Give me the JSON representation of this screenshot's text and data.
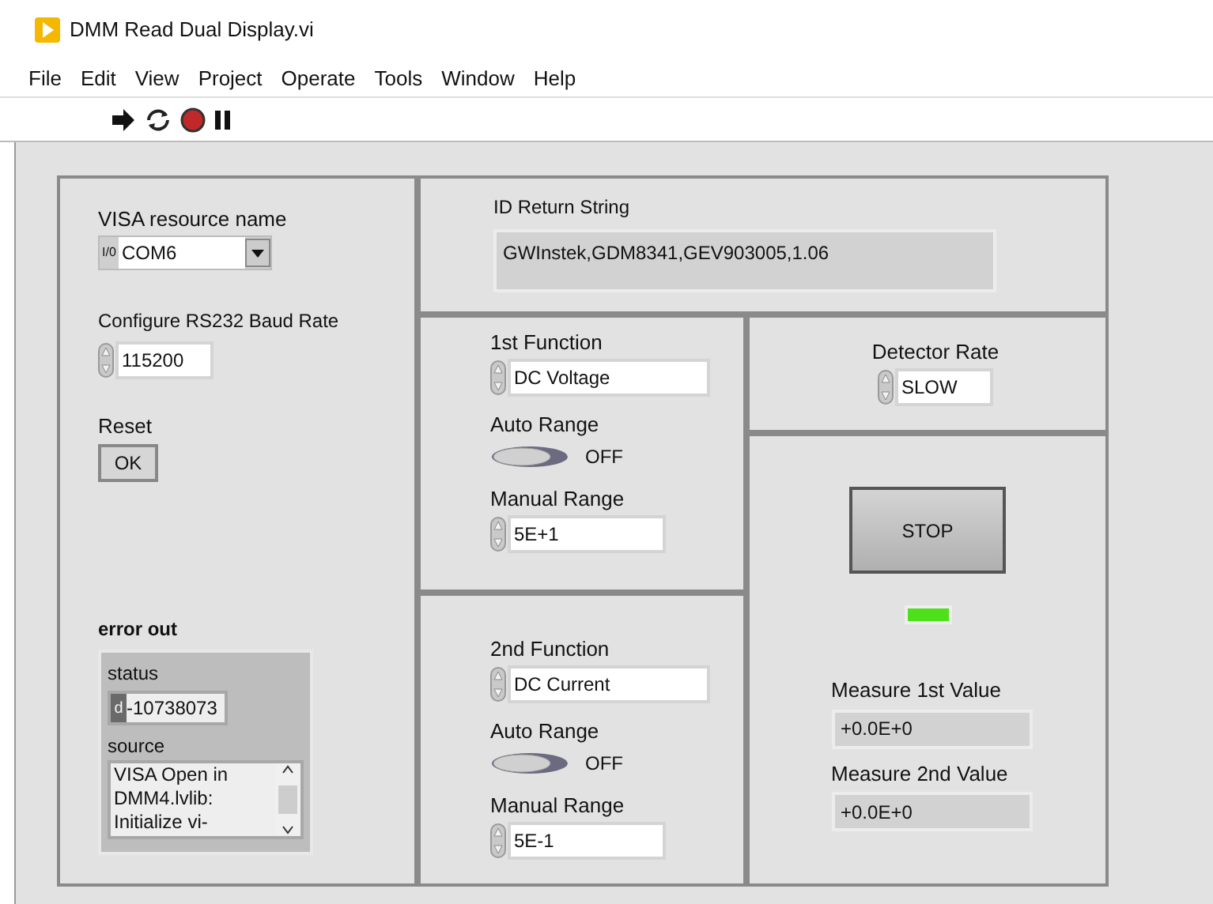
{
  "window": {
    "title": "DMM Read Dual Display.vi"
  },
  "menu": [
    "File",
    "Edit",
    "View",
    "Project",
    "Operate",
    "Tools",
    "Window",
    "Help"
  ],
  "visa": {
    "label": "VISA resource name",
    "prefix": "I/0",
    "value": "COM6"
  },
  "baud": {
    "label": "Configure RS232 Baud Rate",
    "value": "115200"
  },
  "reset": {
    "label": "Reset",
    "button": "OK"
  },
  "error_out": {
    "label": "error out",
    "status_label": "status",
    "code_prefix": "d",
    "code": "-10738073",
    "source_label": "source",
    "source": "VISA Open in DMM4.lvlib: Initialize vi-"
  },
  "id_string": {
    "label": "ID Return String",
    "value": "GWInstek,GDM8341,GEV903005,1.06"
  },
  "functions": [
    {
      "label": "1st Function",
      "value": "DC Voltage",
      "auto_label": "Auto Range",
      "auto_on": false,
      "auto_text": "OFF",
      "manual_label": "Manual Range",
      "manual_value": "5E+1"
    },
    {
      "label": "2nd Function",
      "value": "DC Current",
      "auto_label": "Auto Range",
      "auto_on": false,
      "auto_text": "OFF",
      "manual_label": "Manual Range",
      "manual_value": "5E-1"
    }
  ],
  "detector_rate": {
    "label": "Detector Rate",
    "value": "SLOW"
  },
  "stop_button": "STOP",
  "led": {
    "on": true
  },
  "measures": [
    {
      "label": "Measure 1st Value",
      "value": "+0.0E+0"
    },
    {
      "label": "Measure 2nd Value",
      "value": "+0.0E+0"
    }
  ]
}
